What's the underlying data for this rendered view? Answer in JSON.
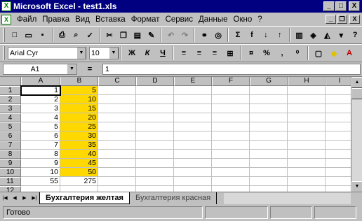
{
  "window": {
    "title": "Microsoft Excel - test1.xls",
    "app_icon": "excel-icon",
    "buttons": [
      "_",
      "□",
      "X"
    ]
  },
  "menubar": {
    "items": [
      "Файл",
      "Правка",
      "Вид",
      "Вставка",
      "Формат",
      "Сервис",
      "Данные",
      "Окно",
      "?"
    ],
    "doc_buttons": [
      "_",
      "❐",
      "X"
    ]
  },
  "standard_toolbar": {
    "icons": [
      "new-icon",
      "open-icon",
      "save-icon",
      "print-icon",
      "print-preview-icon",
      "spelling-icon",
      "cut-icon",
      "copy-icon",
      "paste-icon",
      "format-painter-icon",
      "undo-icon",
      "redo-icon",
      "hyperlink-icon",
      "web-toolbar-icon",
      "autosum-icon",
      "function-icon",
      "sort-ascending-icon",
      "sort-descending-icon",
      "chart-wizard-icon",
      "map-icon",
      "drawing-icon",
      "zoom-icon",
      "help-icon"
    ]
  },
  "formatting_toolbar": {
    "font_name": "Arial Cyr",
    "font_size": "10",
    "bold": "Ж",
    "italic": "К",
    "underline": "Ч",
    "icons": [
      "align-left-icon",
      "align-center-icon",
      "align-right-icon",
      "merge-center-icon",
      "currency-icon",
      "percent-icon",
      "comma-icon",
      "increase-decimal-icon",
      "borders-icon",
      "fill-color-icon",
      "font-color-icon"
    ]
  },
  "formula_bar": {
    "name_box": "A1",
    "equals": "=",
    "formula": "1"
  },
  "grid": {
    "columns": [
      "A",
      "B",
      "C",
      "D",
      "E",
      "F",
      "G",
      "H",
      "I"
    ],
    "rows": [
      "1",
      "2",
      "3",
      "4",
      "5",
      "6",
      "7",
      "8",
      "9",
      "10",
      "11",
      "12"
    ],
    "col_a": [
      "1",
      "2",
      "3",
      "4",
      "5",
      "6",
      "7",
      "8",
      "9",
      "10",
      "55",
      ""
    ],
    "col_b": [
      "5",
      "10",
      "15",
      "20",
      "25",
      "30",
      "35",
      "40",
      "45",
      "50",
      "275",
      ""
    ],
    "highlight_color": "#FFD800",
    "active_cell": "A1"
  },
  "sheet_tabs": {
    "tabs": [
      "Бухгалтерия желтая",
      "Бухгалтерия красная"
    ],
    "active": "Бухгалтерия желтая"
  },
  "status": {
    "text": "Готово"
  }
}
